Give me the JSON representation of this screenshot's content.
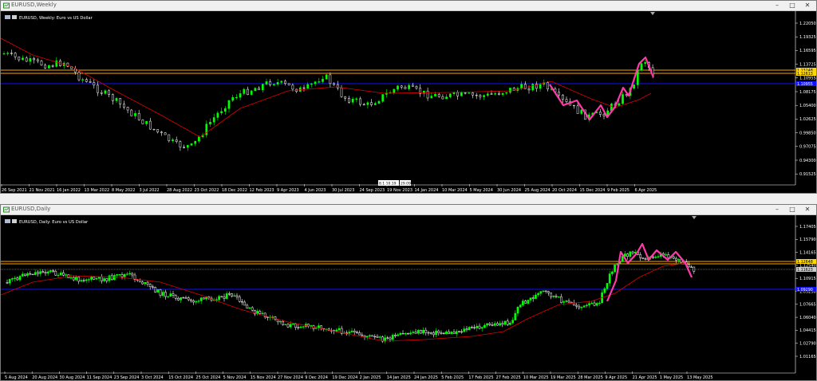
{
  "colors": {
    "background": "#000000",
    "bull_candle": "#00ff00",
    "bear_candle": "#ffffff",
    "moving_average": "#ff0000",
    "pattern_line": "#ff3aa8",
    "resistance_line": "#ffa500",
    "support_line": "#0000ff",
    "price_label_bg": "#ffd700",
    "dotted_line": "#aaaaaa"
  },
  "weekly": {
    "window_title": "EURUSD,Weekly",
    "info_label": "EURUSD, Weekly: Euro vs US Dollar",
    "price_axis_labels": [
      "1.22050",
      "1.19325",
      "1.16595",
      "1.13725",
      "1.10955",
      "1.08175",
      "1.05400",
      "1.02625",
      "0.99850",
      "0.97075",
      "0.94300",
      "0.91525"
    ],
    "price_tags": [
      "1.13248",
      "1.12613",
      "1.10955"
    ],
    "crosshair_tags": [
      "8.1 10.19",
      "29.09"
    ],
    "time_axis_labels": [
      "26 Sep 2021",
      "21 Nov 2021",
      "16 Jan 2022",
      "13 Mar 2022",
      "8 May 2022",
      "3 Jul 2022",
      "28 Aug 2022",
      "23 Oct 2022",
      "18 Dec 2022",
      "12 Feb 2023",
      "9 Apr 2023",
      "4 Jun 2023",
      "30 Jul 2023",
      "24 Sep 2023",
      "19 Nov 2023",
      "14 Jan 2024",
      "10 Mar 2024",
      "5 May 2024",
      "30 Jun 2024",
      "25 Aug 2024",
      "20 Oct 2024",
      "15 Dec 2024",
      "9 Feb 2025",
      "6 Apr 2025"
    ],
    "window_buttons": [
      "–",
      "□",
      "✕"
    ]
  },
  "daily": {
    "window_title": "EURUSD,Daily",
    "info_label": "EURUSD, Daily: Euro vs US Dollar",
    "price_axis_labels": [
      "1.17405",
      "1.15790",
      "1.14165",
      "1.12540",
      "1.10915",
      "1.09290",
      "1.07665",
      "1.06040",
      "1.04415",
      "1.02790",
      "1.01165"
    ],
    "price_tags": [
      "1.12648",
      "1.11623",
      "1.09290"
    ],
    "time_axis_labels": [
      "5 Aug 2024",
      "20 Aug 2024",
      "30 Aug 2024",
      "11 Sep 2024",
      "23 Sep 2024",
      "3 Oct 2024",
      "15 Oct 2024",
      "25 Oct 2024",
      "5 Nov 2024",
      "15 Nov 2024",
      "27 Nov 2024",
      "9 Dec 2024",
      "19 Dec 2024",
      "2 Jan 2025",
      "14 Jan 2025",
      "24 Jan 2025",
      "5 Feb 2025",
      "17 Feb 2025",
      "27 Feb 2025",
      "10 Mar 2025",
      "19 Mar 2025",
      "28 Mar 2025",
      "9 Apr 2025",
      "21 Apr 2025",
      "1 May 2025",
      "13 May 2025"
    ],
    "window_buttons": [
      "–",
      "□",
      "✕"
    ]
  }
}
